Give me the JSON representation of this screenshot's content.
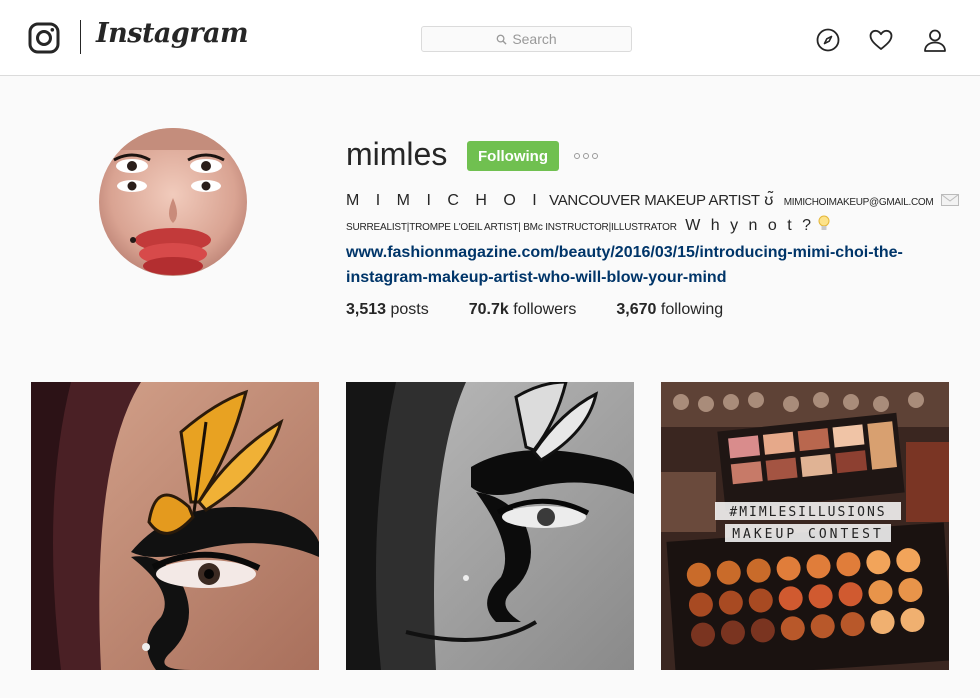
{
  "header": {
    "brand": "Instagram",
    "search_placeholder": "Search",
    "icons": [
      "instagram-camera-icon",
      "compass-icon",
      "heart-icon",
      "person-icon"
    ]
  },
  "profile": {
    "username": "mimles",
    "follow_button": "Following",
    "bio": {
      "name": "M I M I   C H O I",
      "role": "VANCOUVER MAKEUP ARTIST",
      "glyph": "ʊ̃",
      "email": "MIMICHOIMAKEUP@GMAIL.COM",
      "tags": "SURREALIST|TROMPE L'OEIL ARTIST| BMc INSTRUCTOR|ILLUSTRATOR",
      "tagline": "W h y  n o t ?"
    },
    "link": "www.fashionmagazine.com/beauty/2016/03/15/introducing-mimi-choi-the-instagram-makeup-artist-who-will-blow-your-mind",
    "stats": [
      {
        "count": "3,513",
        "label": "posts"
      },
      {
        "count": "70.7k",
        "label": "followers"
      },
      {
        "count": "3,670",
        "label": "following"
      }
    ]
  },
  "grid": {
    "posts": [
      {
        "overlay_text": ""
      },
      {
        "overlay_text": ""
      },
      {
        "overlay_line1": "#MIMLESILLUSIONS",
        "overlay_line2": "MAKEUP CONTEST"
      }
    ]
  },
  "colors": {
    "following_green": "#70c050",
    "link_blue": "#003569",
    "border": "#dbdbdb"
  }
}
